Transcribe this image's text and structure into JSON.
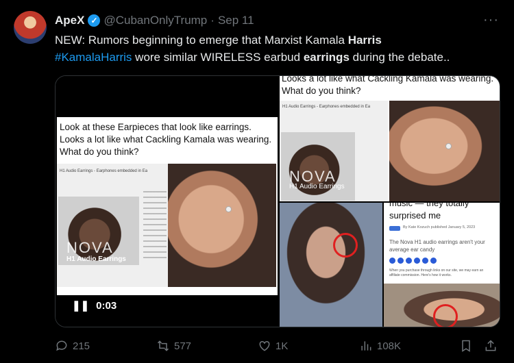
{
  "post": {
    "author_name": "ApeX",
    "verified_mark": "✓",
    "handle": "@CubanOnlyTrump",
    "separator": "·",
    "date": "Sep 11",
    "more_menu": "···",
    "text": {
      "part1": "NEW: Rumors beginning to emerge that Marxist Kamala ",
      "bold1": "Harris",
      "hashtag": "#KamalaHarris",
      "part2": " wore similar WIRELESS earbud ",
      "bold2": "earrings",
      "part3": " during the debate.."
    }
  },
  "media": {
    "left": {
      "caption": "Look at these Earpieces that look like earrings. Looks a lot like what Cackling Kamala was wearing. What do you think?",
      "site_heading": "H1 Audio Earrings - Earphones embedded in Ea",
      "brand": "NOVA",
      "sub_brand": "H1 Audio Earrings"
    },
    "video": {
      "pause_icon": "❚❚",
      "time": "0:03"
    },
    "top_right": {
      "caption": "Looks a lot like what Cackling Kamala was wearing. What do you think?",
      "site_heading": "H1 Audio Earrings - Earphones embedded in Ea",
      "brand": "NOVA",
      "sub_brand": "H1 Audio Earrings"
    },
    "bottom_right": {
      "heading": "music — they totally surprised me",
      "byline": "By Kate Kozuch published January 5, 2023",
      "subtitle": "The Nova H1 audio earrings aren't your average ear candy",
      "small_text": "When you purchase through links on our site, we may earn an affiliate commission. Here's how it works."
    }
  },
  "actions": {
    "replies": "215",
    "reposts": "577",
    "likes": "1K",
    "views": "108K"
  },
  "colors": {
    "background": "#000000",
    "text": "#e7e9ea",
    "muted": "#71767b",
    "accent": "#1d9bf0",
    "highlight_circle": "#e02020"
  }
}
